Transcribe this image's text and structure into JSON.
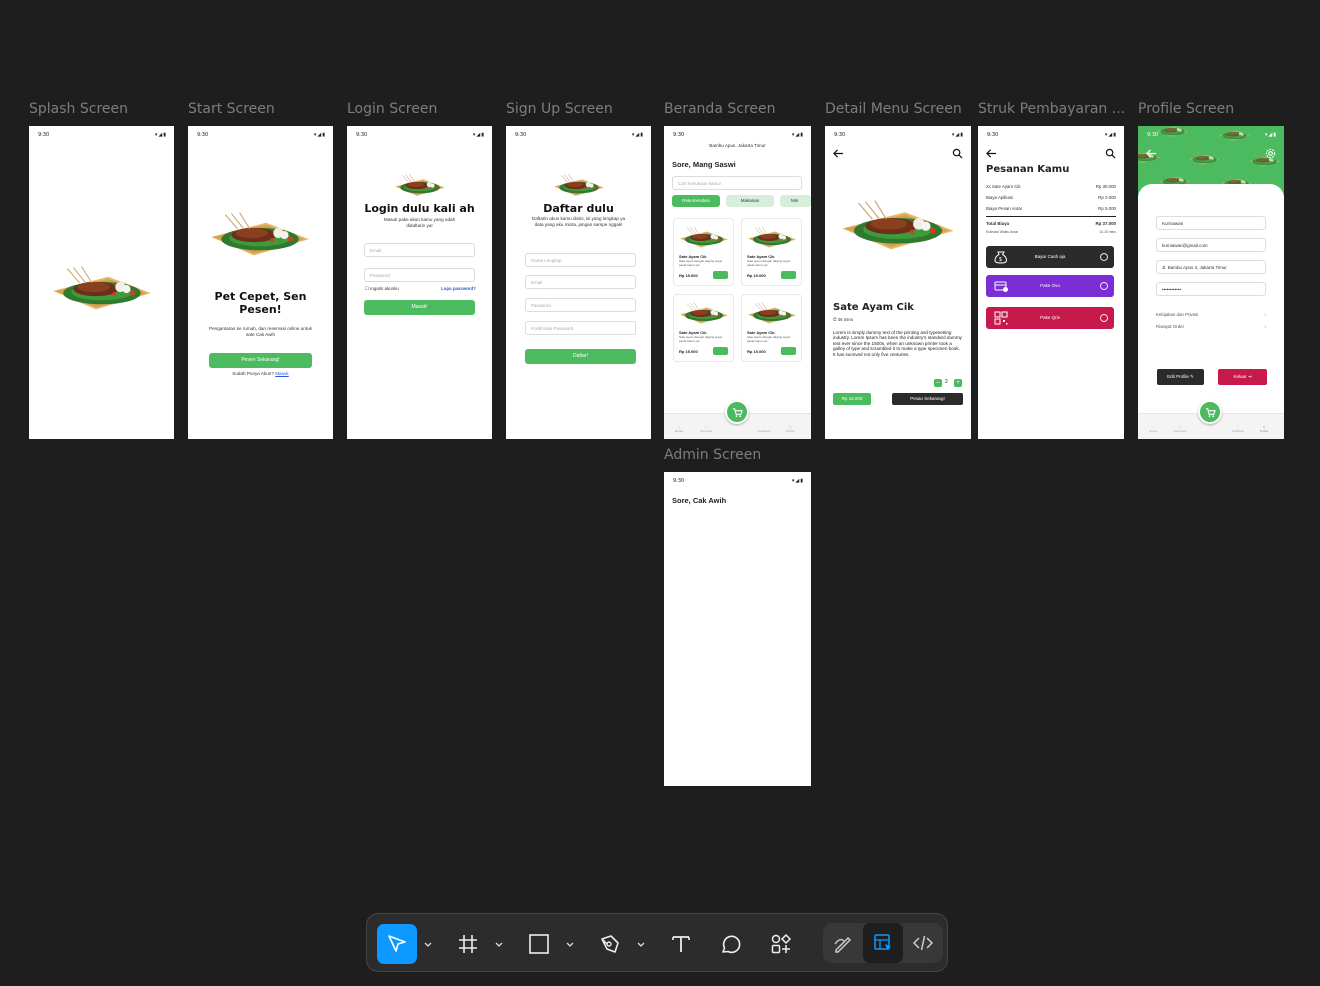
{
  "frames": [
    {
      "key": "splash",
      "label": "Splash Screen"
    },
    {
      "key": "start",
      "label": "Start Screen"
    },
    {
      "key": "login",
      "label": "Login Screen"
    },
    {
      "key": "signup",
      "label": "Sign Up Screen"
    },
    {
      "key": "beranda",
      "label": "Beranda Screen"
    },
    {
      "key": "detail",
      "label": "Detail Menu Screen"
    },
    {
      "key": "struk",
      "label": "Struk Pembayaran ..."
    },
    {
      "key": "profile",
      "label": "Profile Screen"
    },
    {
      "key": "admin",
      "label": "Admin Screen"
    }
  ],
  "status_time": "9:30",
  "start": {
    "title": "Pet Cepet, Sen Pesen!",
    "subtitle": "Pengantaran ke rumah, dan reservasi online untuk sate Cak Awih",
    "cta": "Pesen Sekarang!",
    "have_account": "Sudah Punya Akun?",
    "login_link": "Masuk"
  },
  "login": {
    "title": "Login dulu kali ah",
    "subtitle": "Masuk pake akun kamu yang udah didaftarin ya!",
    "email_ph": "Email",
    "password_ph": "Password",
    "remember": "Ingatin akunku",
    "forgot": "Lupa password?",
    "submit": "Masuk!"
  },
  "signup": {
    "title": "Daftar dulu",
    "subtitle": "Daftarin akun kamu disini, isi yang lengkap ya data yang aku minta, jangan sampe nggak!",
    "name_ph": "Nama Lengkap",
    "email_ph": "Email",
    "password_ph": "Password",
    "confirm_ph": "Konfirmasi Password",
    "submit": "Daftar!"
  },
  "beranda": {
    "location": "Bambu Apus, Jakarta Timur",
    "greeting": "Sore, Mang Saswi",
    "search_ph": "Cari Kesukaan kamu!",
    "chips": [
      "Rekomendasi",
      "Makanan",
      "Min"
    ],
    "cards": [
      {
        "name": "Sate Ayam Cik",
        "desc": "Sate ayam dengan daging super pasar kamu ya!",
        "price": "Rp 15.000"
      },
      {
        "name": "Sate Ayam Cik",
        "desc": "Sate ayam dengan daging super pasar kamu ya!",
        "price": "Rp 15.000"
      },
      {
        "name": "Sate Ayam Cik",
        "desc": "Sate ayam dengan daging super pasar kamu ya!",
        "price": "Rp 15.000"
      },
      {
        "name": "Sate Ayam Cik",
        "desc": "Sate ayam dengan daging super pasar kamu ya!",
        "price": "Rp 15.000"
      }
    ],
    "nav": [
      "Home",
      "Informasi",
      "Notifikasi",
      "Profile"
    ]
  },
  "detail": {
    "name": "Sate Ayam Cik",
    "time": "36 mins",
    "desc": "Lorem is simply dummy text of the printing and typesetting industry. Lorem Ipsum has been the industry's standard dummy text ever since the 1500s, when an unknown printer took a galley of type and scrambled it to make a type specimen book. It has survived not only five centuries.",
    "qty": "2",
    "price": "Rp 15.000",
    "order": "Pesan Sekarang!"
  },
  "struk": {
    "title": "Pesanan Kamu",
    "items": [
      {
        "label": "2x Sate Ayam Cik",
        "value": "Rp 30.000"
      },
      {
        "label": "Biaya Aplikasi",
        "value": "Rp 2.000"
      },
      {
        "label": "Biaya Pesan Antar",
        "value": "Rp 5.000"
      }
    ],
    "total_label": "Total Biaya",
    "total_value": "Rp 37.000",
    "eta_label": "Estimasi Waktu Antar",
    "eta_value": "10-15 mins",
    "payments": [
      {
        "label": "Bayar Cash aja",
        "color": "#2b2b2b"
      },
      {
        "label": "Pake Ovo",
        "color": "#7b2ed6"
      },
      {
        "label": "Pake Qris",
        "color": "#c8194d"
      }
    ]
  },
  "profile": {
    "name": "Kurniawan",
    "email": "kurniawan@gmail.com",
    "address": "Jl. Bambu Apus 3, Jakarta Timur",
    "password": "••••••••••••",
    "policy": "Kebijakan dan Privasi",
    "history": "Riwayat Order",
    "edit": "Edit Profile",
    "logout": "Keluar"
  },
  "admin": {
    "greeting": "Sore, Cak Awih"
  },
  "colors": {
    "canvas": "#1e1e1e",
    "green": "#4cba5e",
    "accent_blue": "#0d99ff"
  }
}
